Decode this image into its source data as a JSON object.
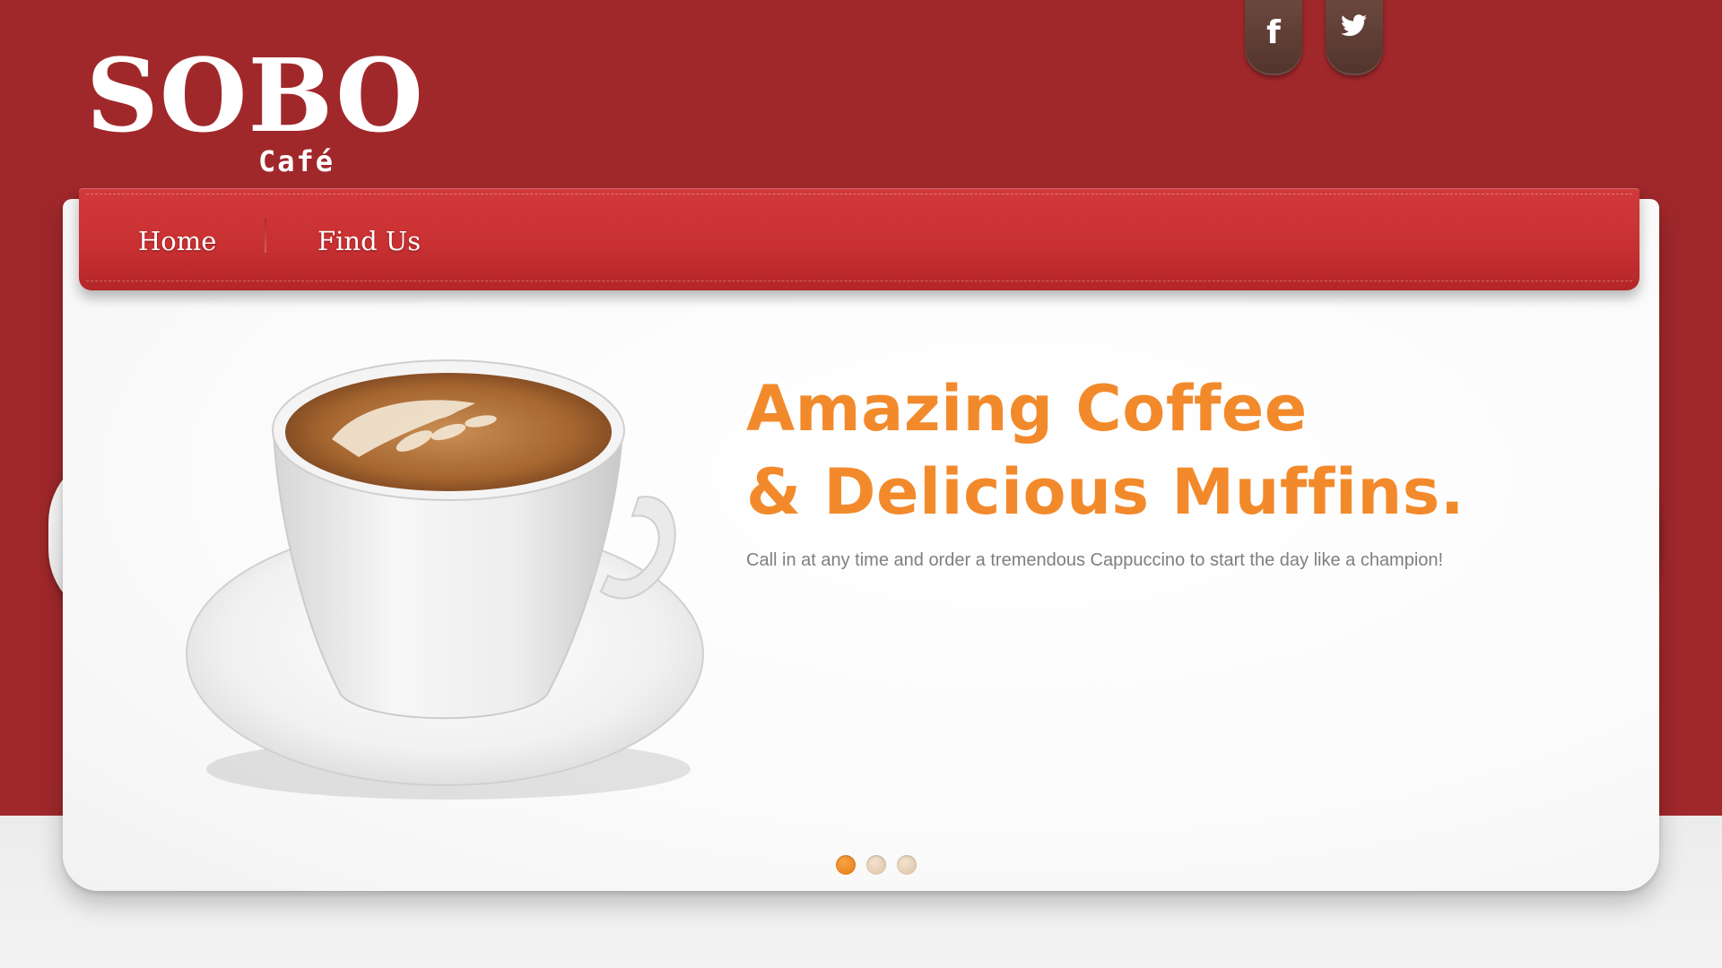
{
  "header": {
    "logo_main": "SOBO",
    "logo_sub": "Café",
    "social": [
      {
        "name": "facebook",
        "icon": "facebook-icon",
        "glyph": "f"
      },
      {
        "name": "twitter",
        "icon": "twitter-icon",
        "glyph": "🐦"
      }
    ]
  },
  "nav": {
    "items": [
      {
        "label": "Home"
      },
      {
        "label": "Find Us"
      }
    ]
  },
  "slider": {
    "headline_line1": "Amazing Coffee",
    "headline_line2": "& Delicious Muffins.",
    "description": "Call in at any time and order a tremendous Cappuccino to start the day like a champion!",
    "prev_arrow": "‹",
    "next_arrow": "›",
    "active_slide": 1,
    "slide_count": 3
  },
  "colors": {
    "brand_red": "#a0282b",
    "nav_red": "#c93032",
    "accent_orange": "#f28a2c",
    "social_brown": "#5e3f36"
  }
}
